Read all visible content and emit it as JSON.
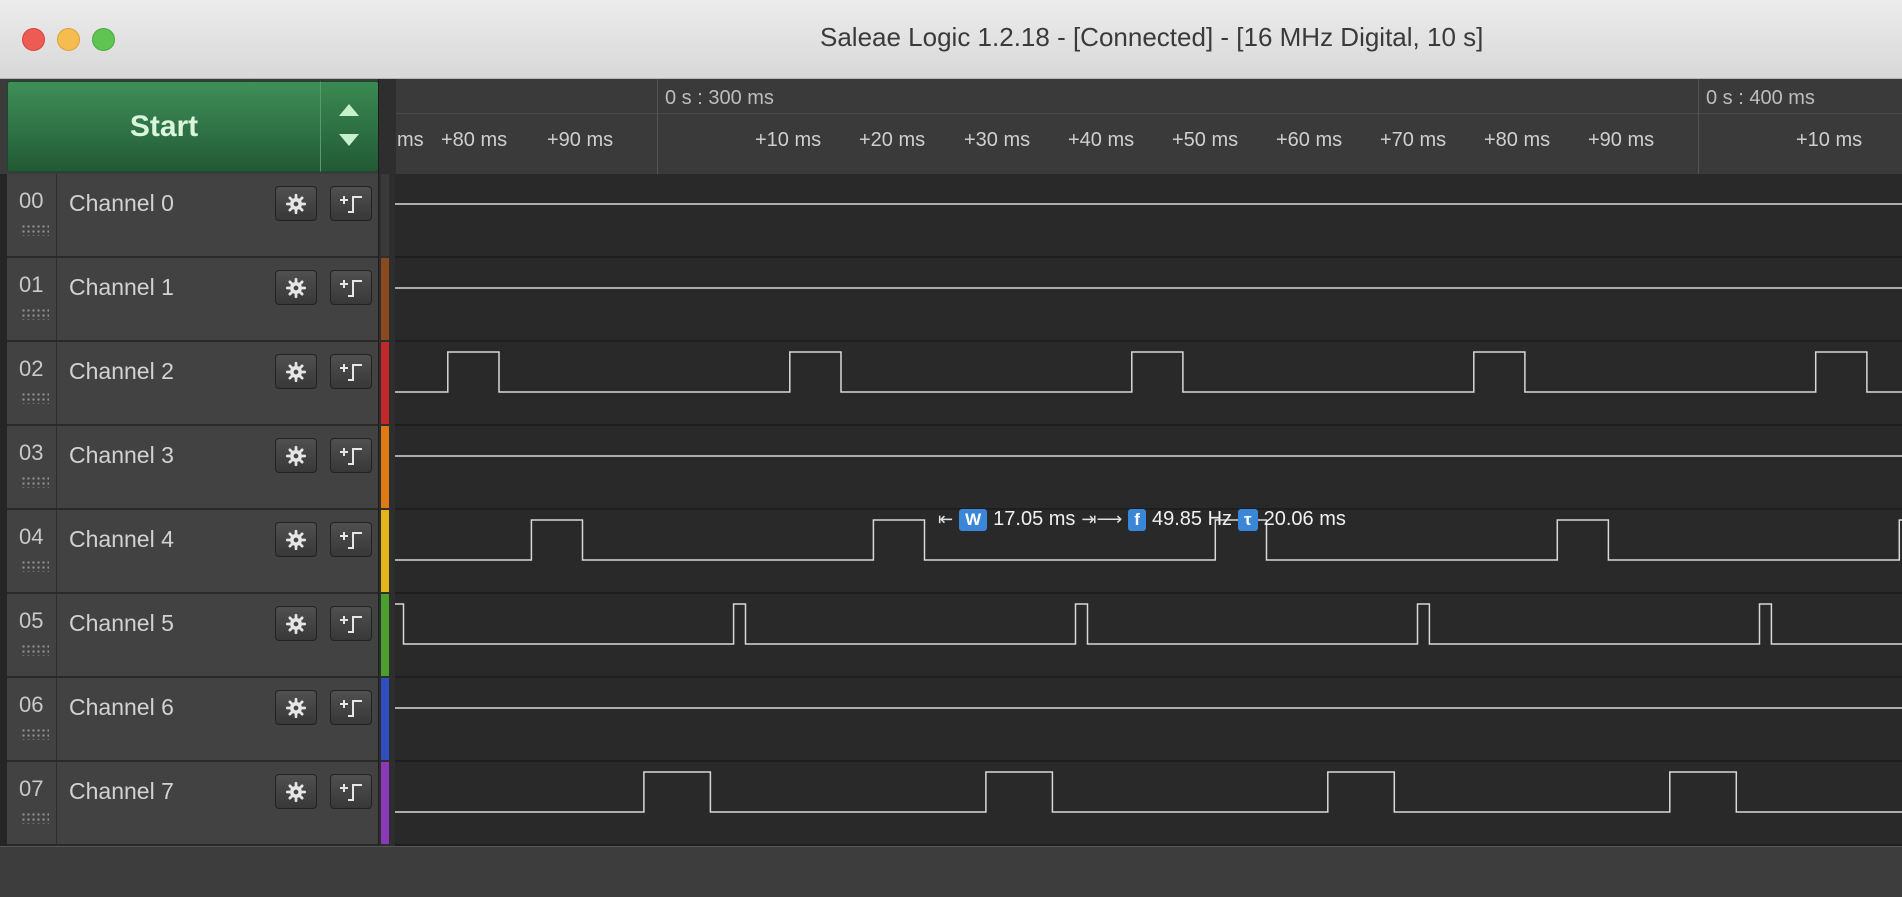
{
  "window": {
    "title": "Saleae Logic 1.2.18 - [Connected] - [16 MHz Digital, 10 s]"
  },
  "controls": {
    "start_label": "Start"
  },
  "ruler": {
    "markers": [
      "0 s : 300 ms",
      "0 s : 400 ms"
    ],
    "ticks": [
      "ms",
      "+80 ms",
      "+90 ms",
      "+10 ms",
      "+20 ms",
      "+30 ms",
      "+40 ms",
      "+50 ms",
      "+60 ms",
      "+70 ms",
      "+80 ms",
      "+90 ms",
      "+10 ms"
    ]
  },
  "channels": [
    {
      "num": "00",
      "name": "Channel 0",
      "color": "#3a3a3a"
    },
    {
      "num": "01",
      "name": "Channel 1",
      "color": "#8b4a1e"
    },
    {
      "num": "02",
      "name": "Channel 2",
      "color": "#c0282a"
    },
    {
      "num": "03",
      "name": "Channel 3",
      "color": "#e07a12"
    },
    {
      "num": "04",
      "name": "Channel 4",
      "color": "#e6b51a"
    },
    {
      "num": "05",
      "name": "Channel 5",
      "color": "#4aa02c"
    },
    {
      "num": "06",
      "name": "Channel 6",
      "color": "#2f4fc0"
    },
    {
      "num": "07",
      "name": "Channel 7",
      "color": "#8a3ab8"
    }
  ],
  "measurement": {
    "width_icon": "W",
    "width_value": "17.05 ms",
    "freq_icon": "f",
    "freq_value": "49.85 Hz",
    "period_icon": "τ",
    "period_value": "20.06 ms"
  },
  "signals": {
    "period_ms": 20.06,
    "ms_per_view": 88.4,
    "channel2": {
      "first_rise_ms": 3.1,
      "high_ms": 3.0
    },
    "channel4": {
      "first_rise_ms": 8.0,
      "high_ms": 3.0
    },
    "channel5": {
      "first_rise_ms": -0.2,
      "high_ms": 0.7
    },
    "channel7": {
      "first_rise_ms": 14.6,
      "high_ms": 3.9
    }
  }
}
